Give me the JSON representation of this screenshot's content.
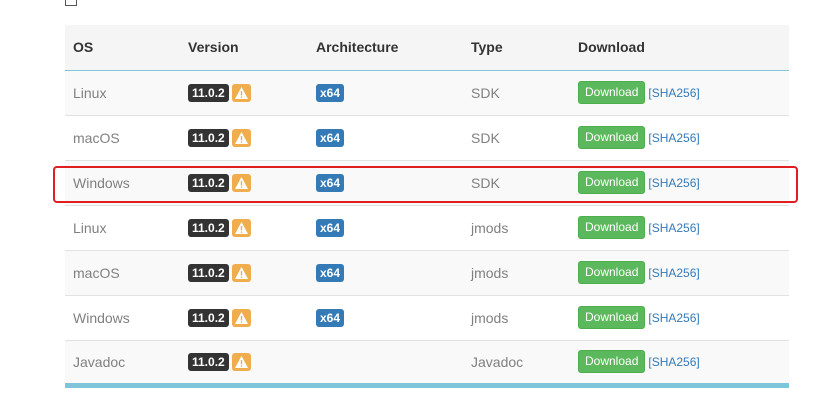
{
  "table": {
    "headers": {
      "os": "OS",
      "version": "Version",
      "architecture": "Architecture",
      "type": "Type",
      "download": "Download"
    },
    "rows": [
      {
        "os": "Linux",
        "version": "11.0.2",
        "arch": "x64",
        "type": "SDK",
        "download_label": "Download",
        "sha_label": "[SHA256]"
      },
      {
        "os": "macOS",
        "version": "11.0.2",
        "arch": "x64",
        "type": "SDK",
        "download_label": "Download",
        "sha_label": "[SHA256]"
      },
      {
        "os": "Windows",
        "version": "11.0.2",
        "arch": "x64",
        "type": "SDK",
        "download_label": "Download",
        "sha_label": "[SHA256]"
      },
      {
        "os": "Linux",
        "version": "11.0.2",
        "arch": "x64",
        "type": "jmods",
        "download_label": "Download",
        "sha_label": "[SHA256]"
      },
      {
        "os": "macOS",
        "version": "11.0.2",
        "arch": "x64",
        "type": "jmods",
        "download_label": "Download",
        "sha_label": "[SHA256]"
      },
      {
        "os": "Windows",
        "version": "11.0.2",
        "arch": "x64",
        "type": "jmods",
        "download_label": "Download",
        "sha_label": "[SHA256]"
      },
      {
        "os": "Javadoc",
        "version": "11.0.2",
        "arch": "",
        "type": "Javadoc",
        "download_label": "Download",
        "sha_label": "[SHA256]"
      }
    ]
  },
  "icons": {
    "warning": "warning-icon"
  },
  "colors": {
    "version_badge": "#333333",
    "warning_badge": "#f0ad4e",
    "arch_badge": "#337ab7",
    "download_button": "#5cb85c",
    "link": "#337ab7",
    "highlight": "#e02020",
    "table_accent": "#7fc4d8"
  },
  "highlighted_row_index": 2
}
